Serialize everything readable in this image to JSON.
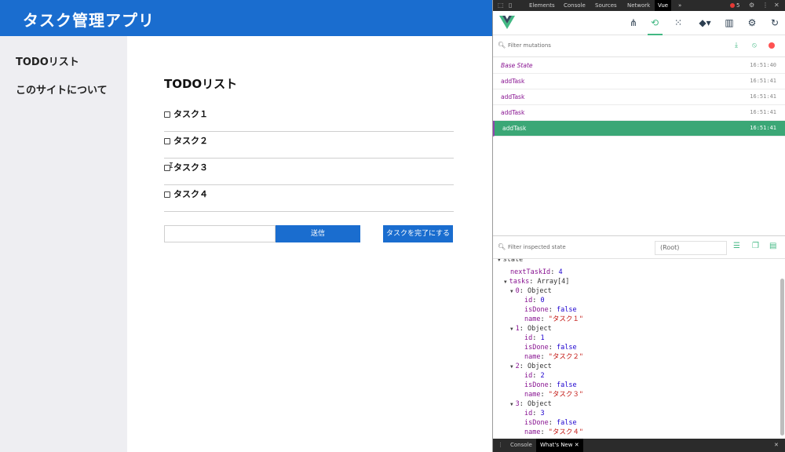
{
  "app": {
    "title": "タスク管理アプリ",
    "nav": [
      "TODOリスト",
      "このサイトについて"
    ],
    "heading": "TODOリスト",
    "tasks": [
      "タスク１",
      "タスク２",
      "タスク３",
      "タスク４"
    ],
    "input_value": "",
    "send_label": "送信",
    "complete_label": "タスクを完了にする",
    "primary_color": "#1a6dcf"
  },
  "devtools": {
    "tabs": [
      "Elements",
      "Console",
      "Sources",
      "Network",
      "Vue"
    ],
    "active_tab": "Vue",
    "more": "»",
    "error_count": "5",
    "mutation_filter_placeholder": "Filter mutations",
    "mutations": [
      {
        "name": "Base State",
        "time": "16:51:40"
      },
      {
        "name": "addTask",
        "time": "16:51:41"
      },
      {
        "name": "addTask",
        "time": "16:51:41"
      },
      {
        "name": "addTask",
        "time": "16:51:41"
      },
      {
        "name": "addTask",
        "time": "16:51:41"
      }
    ],
    "selected_mutation": 4,
    "state_filter_placeholder": "Filter inspected state",
    "root_label": "(Root)",
    "state": {
      "section": "state",
      "nextTaskId_key": "nextTaskId",
      "nextTaskId_val": "4",
      "tasks_key": "tasks",
      "tasks_type": "Array[4]",
      "items": [
        {
          "index": "0",
          "type": "Object",
          "id": "0",
          "isDone": "false",
          "name": "\"タスク１\""
        },
        {
          "index": "1",
          "type": "Object",
          "id": "1",
          "isDone": "false",
          "name": "\"タスク２\""
        },
        {
          "index": "2",
          "type": "Object",
          "id": "2",
          "isDone": "false",
          "name": "\"タスク３\""
        },
        {
          "index": "3",
          "type": "Object",
          "id": "3",
          "isDone": "false",
          "name": "\"タスク４\""
        }
      ]
    },
    "drawer_tabs": [
      "Console",
      "What's New"
    ],
    "accent": "#42b883"
  }
}
